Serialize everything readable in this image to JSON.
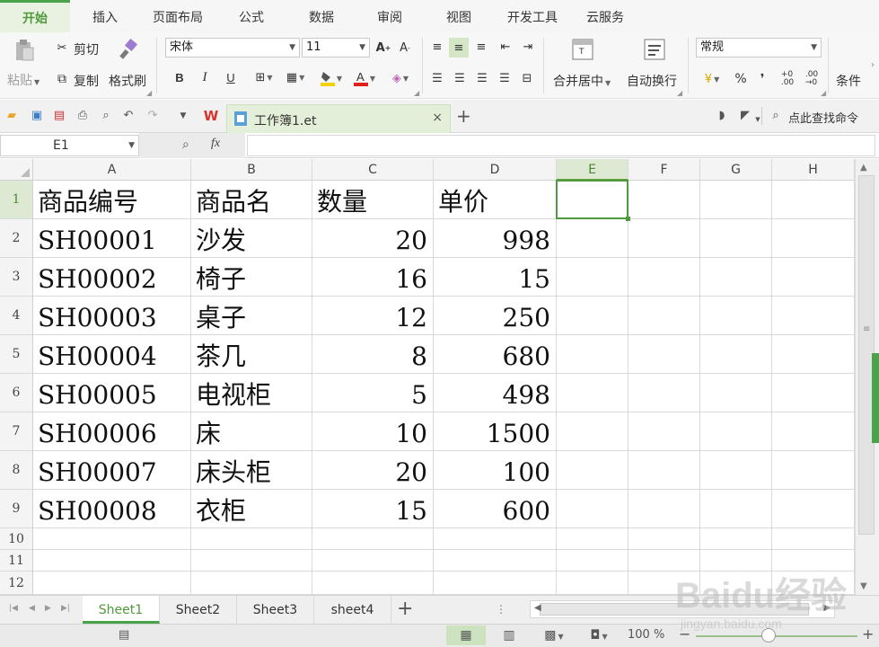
{
  "menu_tabs": [
    "开始",
    "插入",
    "页面布局",
    "公式",
    "数据",
    "审阅",
    "视图",
    "开发工具",
    "云服务"
  ],
  "ribbon": {
    "paste": "粘贴",
    "cut": "剪切",
    "copy": "复制",
    "format_painter": "格式刷",
    "font_name": "宋体",
    "font_size": "11",
    "bold": "B",
    "italic": "I",
    "underline": "U",
    "merge_center": "合并居中",
    "wrap_text": "自动换行",
    "number_format": "常规",
    "percent": "%",
    "comma": "❜",
    "conditional": "条件"
  },
  "quick_access": {
    "doc_name": "工作簿1.et",
    "find_command": "点此查找命令"
  },
  "formula_bar": {
    "name_box": "E1",
    "fx": "fx",
    "value": ""
  },
  "sheet": {
    "columns": [
      "A",
      "B",
      "C",
      "D",
      "E",
      "F",
      "G",
      "H"
    ],
    "rows": [
      "1",
      "2",
      "3",
      "4",
      "5",
      "6",
      "7",
      "8",
      "9",
      "10",
      "11",
      "12"
    ],
    "selected_cell": "E1",
    "data": [
      [
        "商品编号",
        "商品名",
        "数量",
        "单价"
      ],
      [
        "SH00001",
        "沙发",
        "20",
        "998"
      ],
      [
        "SH00002",
        "椅子",
        "16",
        "15"
      ],
      [
        "SH00003",
        "桌子",
        "12",
        "250"
      ],
      [
        "SH00004",
        "茶几",
        "8",
        "680"
      ],
      [
        "SH00005",
        "电视柜",
        "5",
        "498"
      ],
      [
        "SH00006",
        "床",
        "10",
        "1500"
      ],
      [
        "SH00007",
        "床头柜",
        "20",
        "100"
      ],
      [
        "SH00008",
        "衣柜",
        "15",
        "600"
      ]
    ]
  },
  "sheet_tabs": [
    "Sheet1",
    "Sheet2",
    "Sheet3",
    "sheet4"
  ],
  "active_sheet": "Sheet1",
  "status": {
    "zoom": "100 %"
  },
  "watermark": {
    "brand": "Baidu经验",
    "url": "jingyan.baidu.com"
  },
  "colors": {
    "accent": "#4f9a3c",
    "selection_header": "#dde9d2"
  }
}
